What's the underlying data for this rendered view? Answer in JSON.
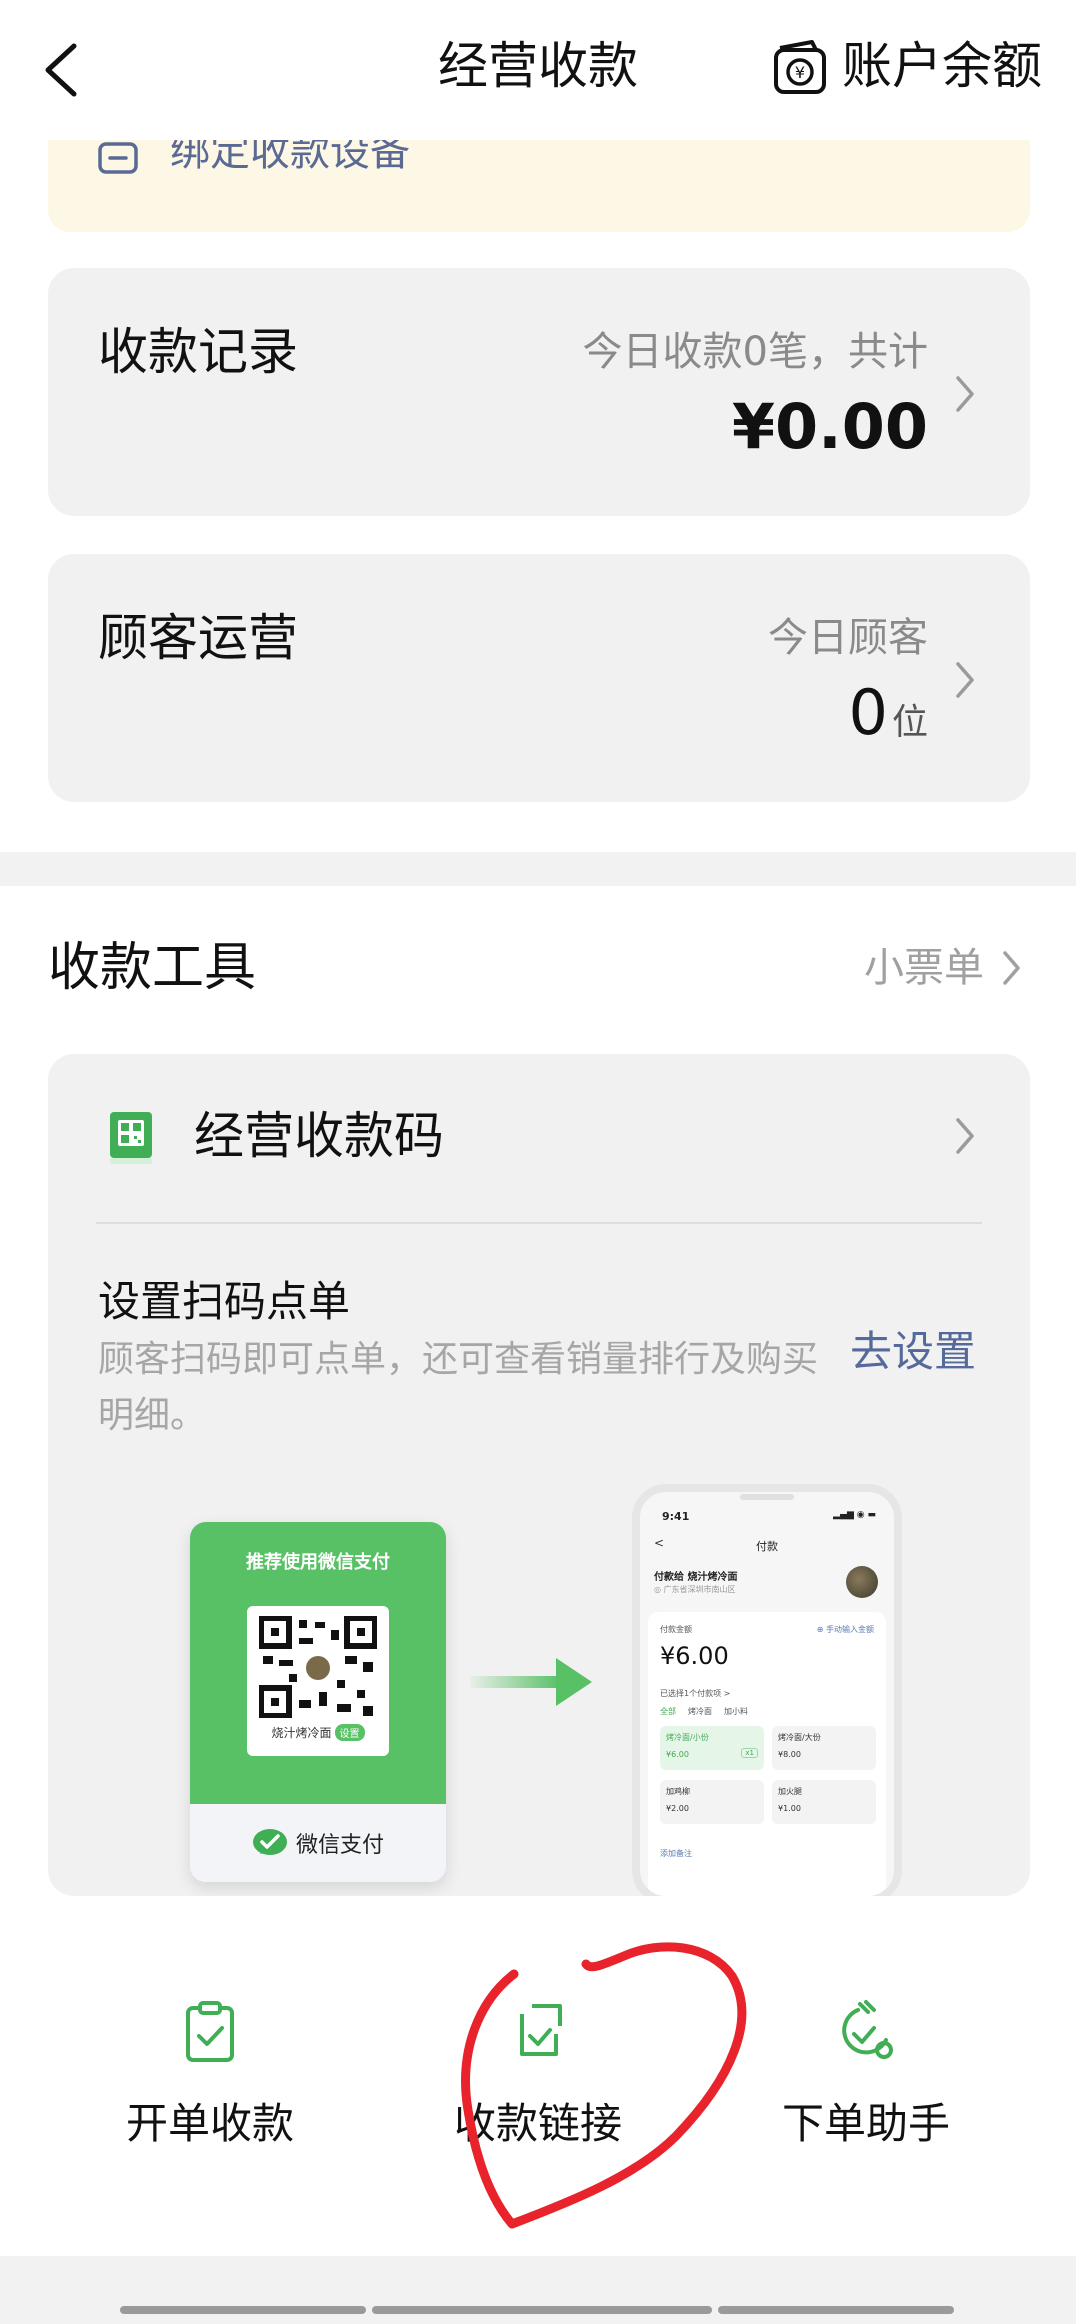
{
  "header": {
    "title": "经营收款",
    "balance_label": "账户余额"
  },
  "notice": {
    "text": "绑定收款设备"
  },
  "records_card": {
    "title": "收款记录",
    "subtitle": "今日收款0笔，共计",
    "amount": "¥0.00"
  },
  "customers_card": {
    "title": "顾客运营",
    "subtitle": "今日顾客",
    "count": "0",
    "unit": "位"
  },
  "tools": {
    "section_title": "收款工具",
    "receipt_label": "小票单",
    "qr_row_label": "经营收款码",
    "scan_order_title": "设置扫码点单",
    "scan_order_desc": "顾客扫码即可点单，还可查看销量排行及购买明细。",
    "scan_order_action": "去设置"
  },
  "illustration": {
    "promo_tag": "推荐使用微信支付",
    "qr_shop_name": "烧汁烤冷面",
    "qr_badge": "设置",
    "pay_brand": "微信支付",
    "phone": {
      "time": "9:41",
      "status": "▂▄▆ ◉ ▬",
      "title": "付款",
      "back": "<",
      "merchant": "付款给 烧汁烤冷面",
      "address": "◎ 广东省深圳市南山区",
      "amount_label": "付款金额",
      "manual_input": "⊕ 手动输入金额",
      "amount": "¥6.00",
      "selected_summary": "已选择1个付款项 >",
      "tabs": [
        "全部",
        "烤冷面",
        "加小料"
      ],
      "items": [
        {
          "name": "烤冷面/小份",
          "price": "¥6.00",
          "selected": true,
          "qty": "x1"
        },
        {
          "name": "烤冷面/大份",
          "price": "¥8.00",
          "selected": false,
          "qty": ""
        },
        {
          "name": "加鸡柳",
          "price": "¥2.00",
          "selected": false,
          "qty": ""
        },
        {
          "name": "加火腿",
          "price": "¥1.00",
          "selected": false,
          "qty": ""
        }
      ],
      "add_note": "添加备注"
    }
  },
  "actions": [
    {
      "label": "开单收款",
      "icon": "clipboard-check-icon"
    },
    {
      "label": "收款链接",
      "icon": "link-check-icon"
    },
    {
      "label": "下单助手",
      "icon": "order-assistant-icon"
    }
  ],
  "colors": {
    "accent_green": "#3fae55",
    "link_blue": "#55699a",
    "card_bg": "#f1f1f1",
    "notice_bg": "#fdf7e5",
    "annotation_red": "#e8232b"
  }
}
